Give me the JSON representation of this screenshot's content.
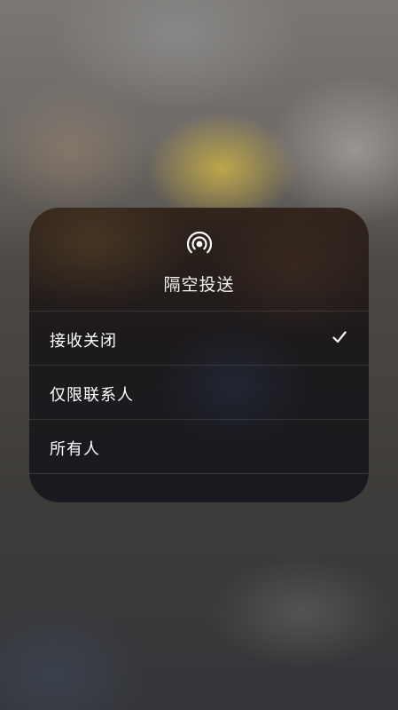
{
  "airdrop": {
    "icon": "airdrop-icon",
    "title": "隔空投送",
    "options": [
      {
        "label": "接收关闭",
        "selected": true
      },
      {
        "label": "仅限联系人",
        "selected": false
      },
      {
        "label": "所有人",
        "selected": false
      }
    ],
    "check_icon": "checkmark-icon"
  }
}
